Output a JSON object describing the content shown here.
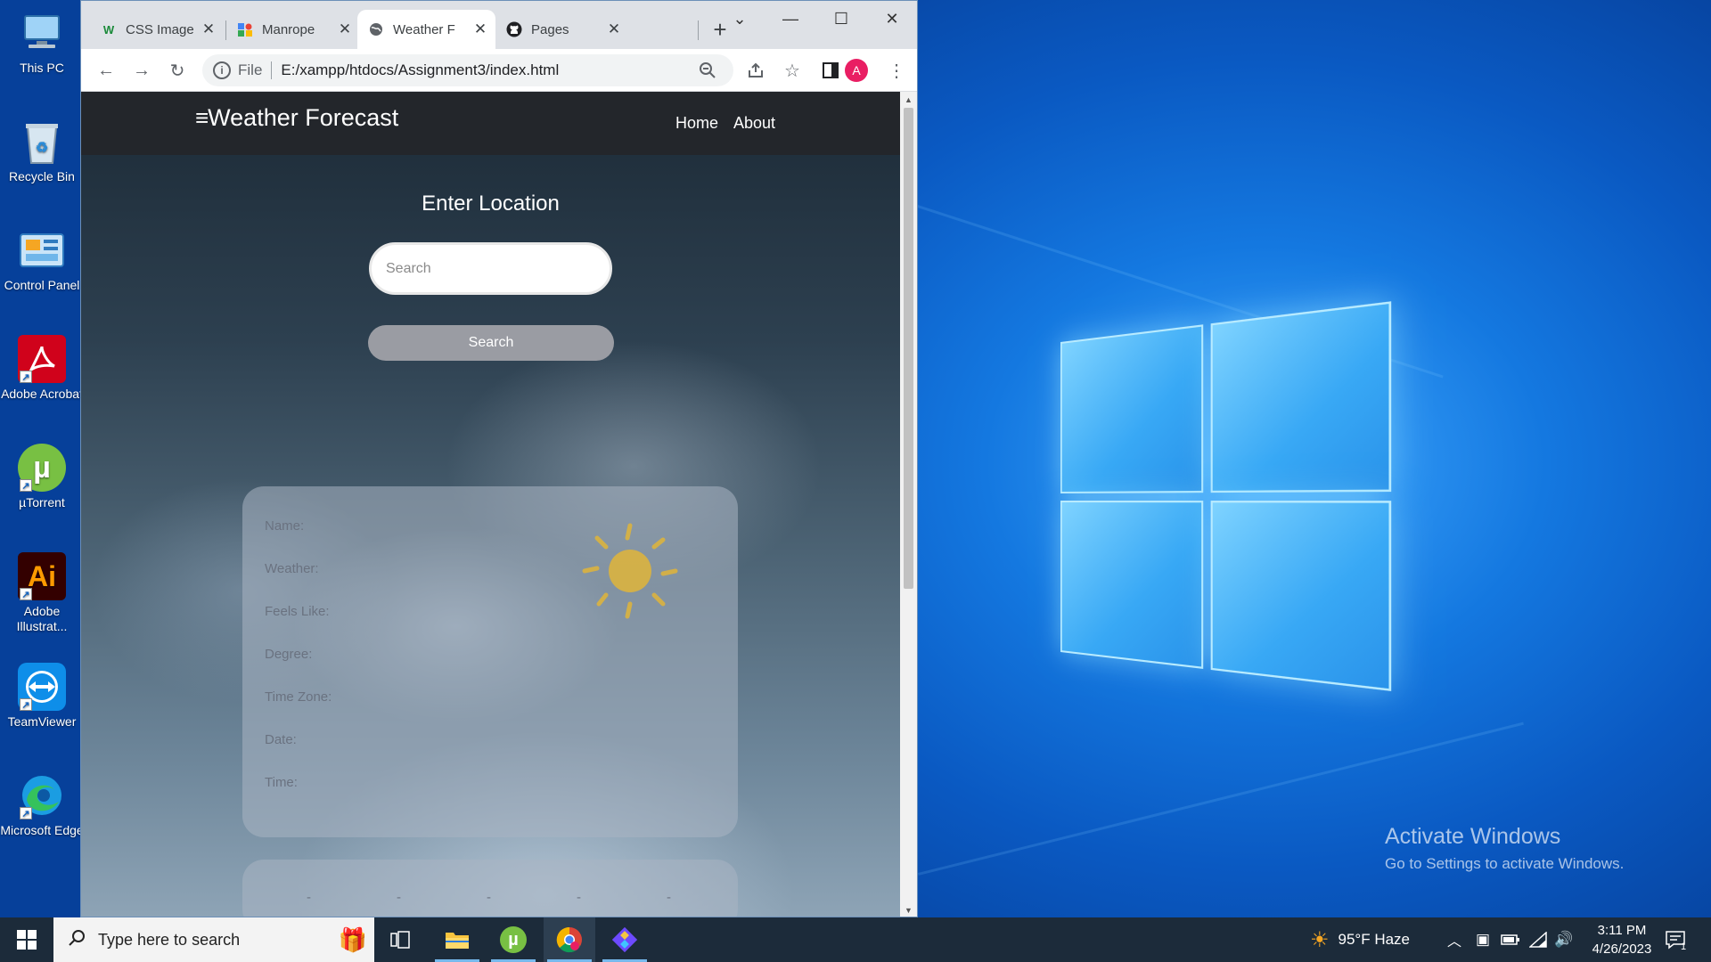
{
  "desktop": {
    "icons": [
      {
        "label": "This PC"
      },
      {
        "label": "Recycle Bin"
      },
      {
        "label": "Control Panel"
      },
      {
        "label": "Adobe Acrobat"
      },
      {
        "label": "µTorrent"
      },
      {
        "label": "Adobe Illustrat..."
      },
      {
        "label": "TeamViewer"
      },
      {
        "label": "Microsoft Edge"
      }
    ],
    "watermark": {
      "title": "Activate Windows",
      "subtitle": "Go to Settings to activate Windows."
    }
  },
  "browser": {
    "tabs": [
      {
        "label": "CSS Image"
      },
      {
        "label": "Manrope"
      },
      {
        "label": "Weather F"
      },
      {
        "label": "Pages"
      }
    ],
    "new_tab": "+",
    "url_scheme": "File",
    "url": "E:/xampp/htdocs/Assignment3/index.html",
    "profile_initial": "A"
  },
  "page": {
    "brand": "Weather Forecast",
    "nav": {
      "home": "Home",
      "about": "About"
    },
    "heading": "Enter Location",
    "search_placeholder": "Search",
    "search_button": "Search",
    "fields": {
      "name": "Name:",
      "weather": "Weather:",
      "feels_like": "Feels Like:",
      "degree": "Degree:",
      "time_zone": "Time Zone:",
      "date": "Date:",
      "time": "Time:"
    },
    "forecast_placeholders": [
      "-",
      "-",
      "-",
      "-",
      "-"
    ]
  },
  "taskbar": {
    "search_placeholder": "Type here to search",
    "weather": "95°F  Haze",
    "time": "3:11 PM",
    "date": "4/26/2023",
    "notification_count": "1"
  }
}
